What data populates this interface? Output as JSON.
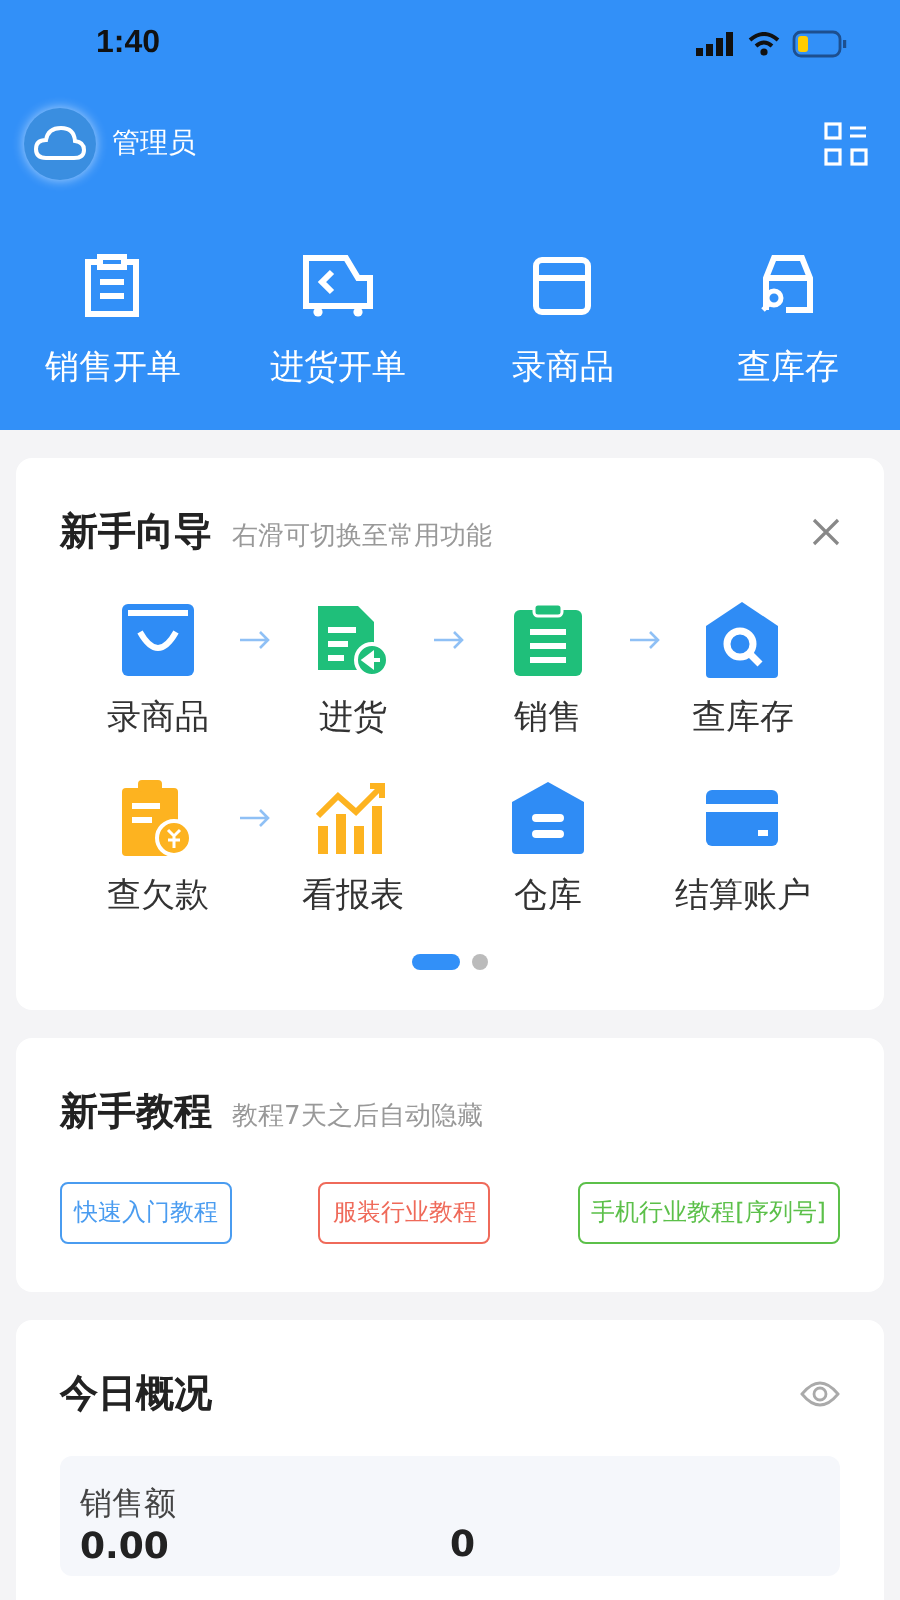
{
  "status_bar": {
    "time": "1:40"
  },
  "header": {
    "user": "管理员"
  },
  "quick_actions": [
    {
      "label": "销售开单"
    },
    {
      "label": "进货开单"
    },
    {
      "label": "录商品"
    },
    {
      "label": "查库存"
    }
  ],
  "guide": {
    "title": "新手向导",
    "hint": "右滑可切换至常用功能",
    "items": [
      {
        "label": "录商品",
        "arrow_after": true
      },
      {
        "label": "进货",
        "arrow_after": true
      },
      {
        "label": "销售",
        "arrow_after": true
      },
      {
        "label": "查库存",
        "arrow_after": false
      },
      {
        "label": "查欠款",
        "arrow_after": true
      },
      {
        "label": "看报表",
        "arrow_after": false
      },
      {
        "label": "仓库",
        "arrow_after": false
      },
      {
        "label": "结算账户",
        "arrow_after": false
      }
    ],
    "pages": [
      {
        "selected": true
      },
      {
        "selected": false
      }
    ]
  },
  "tutorials": {
    "title": "新手教程",
    "hint": "教程7天之后自动隐藏",
    "links": [
      {
        "label": "快速入门教程",
        "color": "#4a9cf0"
      },
      {
        "label": "服装行业教程",
        "color": "#ef6a5a"
      },
      {
        "label": "手机行业教程[序列号]",
        "color": "#5cc04a"
      }
    ]
  },
  "today": {
    "title": "今日概况",
    "stats": [
      {
        "label": "销售额",
        "value": "0.00"
      },
      {
        "value": "0"
      }
    ]
  }
}
